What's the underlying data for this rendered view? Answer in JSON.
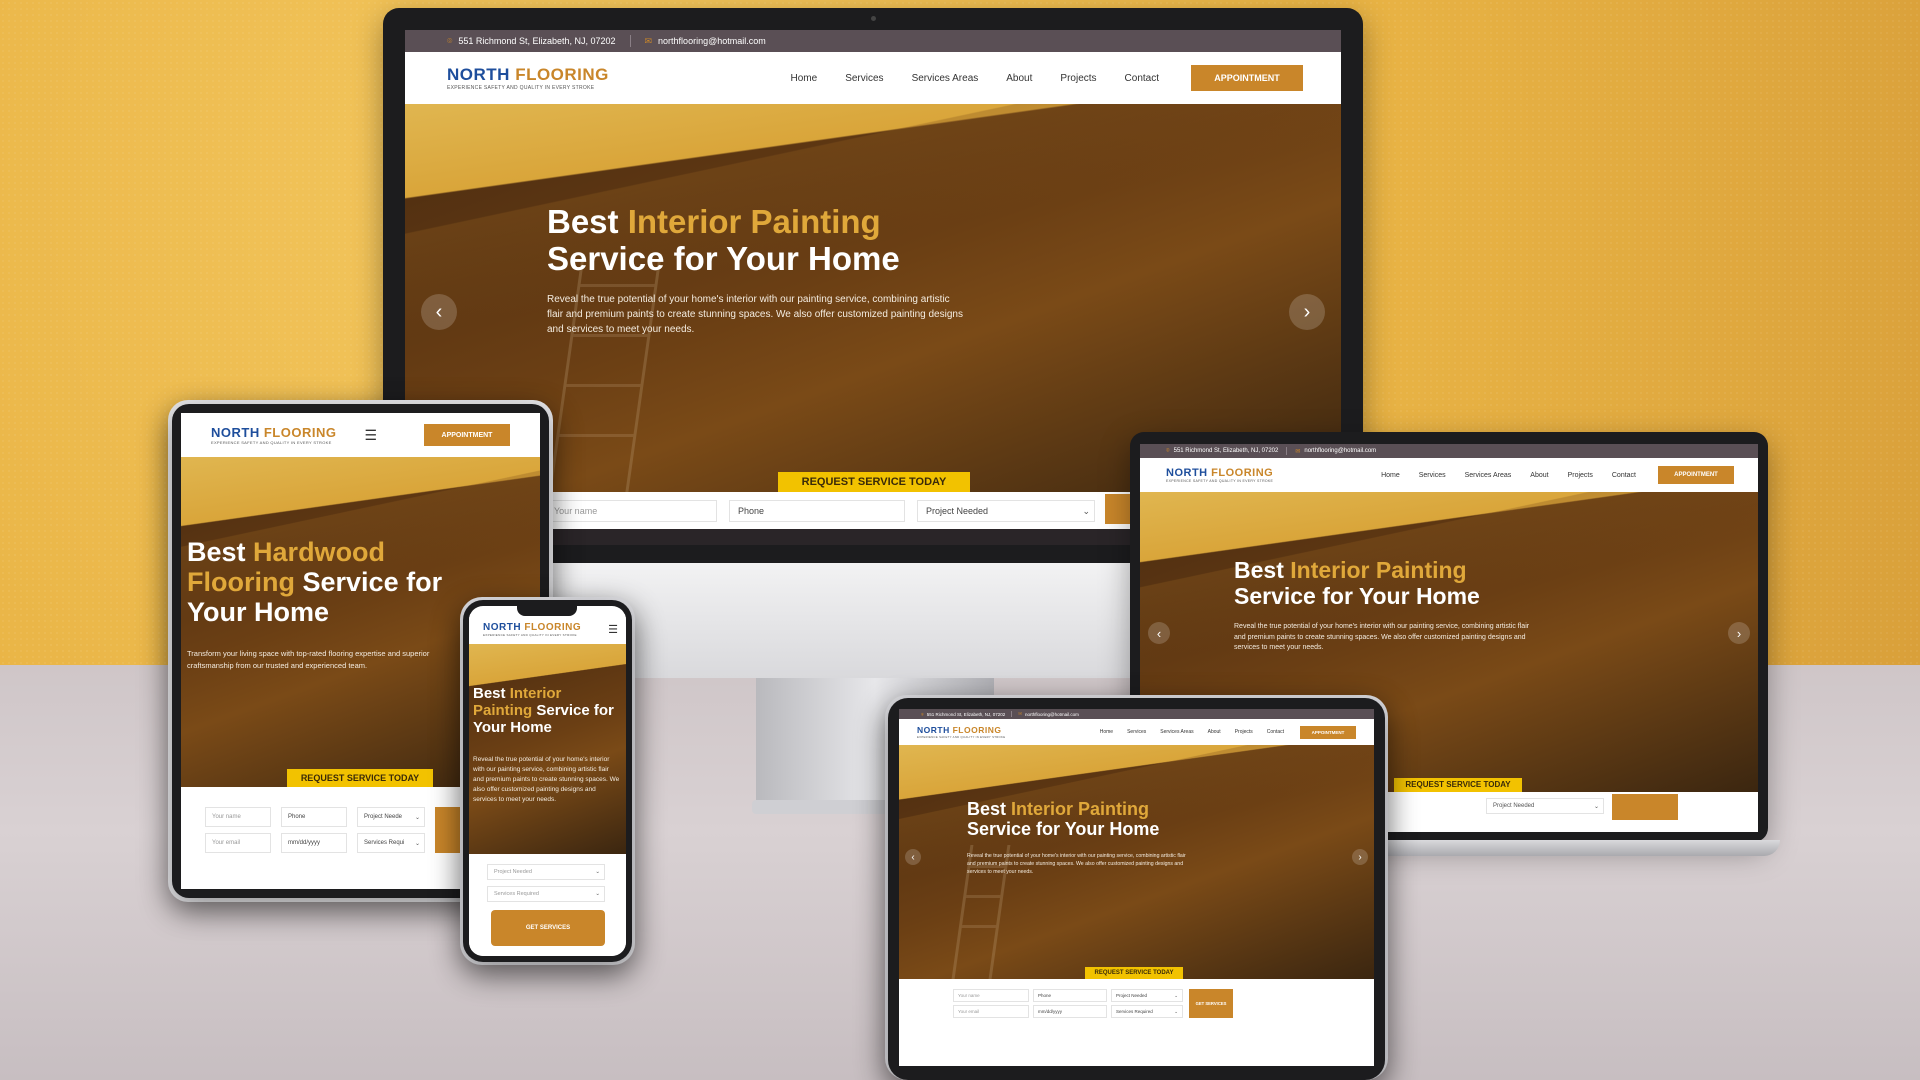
{
  "brand": {
    "name_part1": "NORTH",
    "name_part2": "FLOORING",
    "tagline": "EXPERIENCE SAFETY AND QUALITY IN EVERY STROKE"
  },
  "topbar": {
    "address": "551 Richmond St, Elizabeth, NJ, 07202",
    "email": "northflooring@hotmail.com"
  },
  "nav": {
    "items": [
      "Home",
      "Services",
      "Services Areas",
      "About",
      "Projects",
      "Contact"
    ],
    "appointment": "APPOINTMENT"
  },
  "hero_painting": {
    "title_white1": "Best",
    "title_gold": "Interior Painting",
    "title_white2": "Service for Your Home",
    "description": "Reveal the true potential of your home's interior with our painting service, combining artistic flair and premium paints to create stunning spaces. We also offer customized painting designs and services to meet your needs."
  },
  "hero_flooring": {
    "title_white1": "Best",
    "title_gold1": "Hardwood",
    "title_gold2": "Flooring",
    "title_white2": "Service for",
    "title_white3": "Your Home",
    "description": "Transform your living space with top-rated flooring expertise and superior craftsmanship from our trusted and experienced team."
  },
  "hero_mobile": {
    "title_white1": "Best",
    "title_gold1": "Interior",
    "title_gold2": "Painting",
    "title_white2": "Service for",
    "title_white3": "Your Home",
    "description": "Reveal the true potential of your home's interior with our painting service, combining artistic flair and premium paints to create stunning spaces. We also offer customized painting designs and services to meet your needs."
  },
  "carousel": {
    "prev": "‹",
    "next": "›"
  },
  "request_button": "REQUEST SERVICE TODAY",
  "form": {
    "name_placeholder": "Your name",
    "email_placeholder": "Your email",
    "phone_placeholder": "Phone",
    "date_placeholder": "mm/dd/yyyy",
    "project_select": "Project Needed",
    "project_select_short": "Project Neede",
    "services_select": "Services Required",
    "services_select_short": "Services Requi",
    "get_services": "GET SERVICES"
  }
}
